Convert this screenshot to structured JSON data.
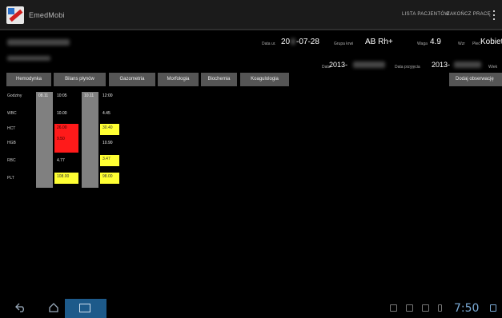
{
  "app": {
    "title": "EmedMobi"
  },
  "actionbar": {
    "action1": "LISTA PACJENTÓW",
    "action2": "ZAKOŃCZ PRACĘ"
  },
  "patient": {
    "birth_label": "Data ur.",
    "birth_value_prefix": "20",
    "birth_value_suffix": "-07-28",
    "blood_label": "Grupa krwi",
    "blood_value": "AB Rh+",
    "weight_label": "Waga",
    "weight_value": "4.9",
    "unit_label": "Wzr",
    "sex_label": "Płeć",
    "sex_value": "Kobiet",
    "date_label": "Data",
    "date_value": "2013-",
    "adm_label": "Data przyjęcia",
    "adm_value": "2013-",
    "extra_label": "Wiek"
  },
  "tabs": [
    "Hemodynka",
    "Bilans płynów",
    "Gazometria",
    "Morfologia",
    "Biochemia",
    "Koagulologia"
  ],
  "add_button": "Dodaj obserwację",
  "grid": {
    "header_label": "Godziny",
    "rows": [
      {
        "label": "WBC",
        "v1": "10.00",
        "v2": "4.45"
      },
      {
        "label": "HCT",
        "v1": "26.00",
        "v2": "30.40"
      },
      {
        "label": "HGB",
        "v1": "9.50",
        "v2": "10.90"
      },
      {
        "label": "RBC",
        "v1": "4.77",
        "v2": "3.47"
      },
      {
        "label": "PLT",
        "v1": "108.00",
        "v2": "98.00"
      }
    ],
    "col1_date": "08.11",
    "col1_time": "10:05",
    "col2_date": "10.11",
    "col2_time": "12:00"
  },
  "status": {
    "clock": "7:50"
  },
  "colors": {
    "red": "#ff1a1a",
    "yellow": "#ffff33",
    "gray": "#808080",
    "nav_accent": "#1d5a8a"
  },
  "icons": [
    "app-logo-icon",
    "overflow-menu-icon",
    "back-icon",
    "home-icon",
    "recent-apps-icon",
    "notification-icon",
    "battery-icon"
  ]
}
